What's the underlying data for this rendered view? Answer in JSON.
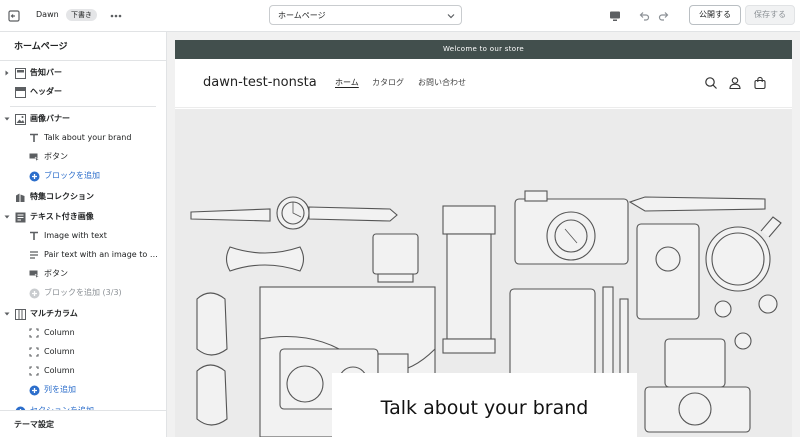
{
  "topbar": {
    "theme_name": "Dawn",
    "status_badge": "下書き",
    "page_select_value": "ホームページ",
    "publish_label": "公開する",
    "save_label": "保存する"
  },
  "sidebar": {
    "title": "ホームページ",
    "sections": [
      {
        "label": "告知バー",
        "icon": "announcement-icon"
      },
      {
        "label": "ヘッダー",
        "icon": "header-icon"
      },
      {
        "label": "画像バナー",
        "icon": "image-icon"
      },
      {
        "label": "Talk about your brand",
        "icon": "text-icon"
      },
      {
        "label": "ボタン",
        "icon": "button-icon"
      },
      {
        "label": "ブロックを追加",
        "icon": "add-icon"
      },
      {
        "label": "特集コレクション",
        "icon": "collection-icon"
      },
      {
        "label": "テキスト付き画像",
        "icon": "image-text-icon"
      },
      {
        "label": "Image with text",
        "icon": "text-icon"
      },
      {
        "label": "Pair text with an image to focus on your chosen product, collection, or blog post.",
        "icon": "paragraph-icon"
      },
      {
        "label": "ボタン",
        "icon": "button-icon"
      },
      {
        "label": "ブロックを追加 (3/3)",
        "icon": "add-icon"
      },
      {
        "label": "マルチカラム",
        "icon": "columns-icon"
      },
      {
        "label": "Column",
        "icon": "column-icon"
      },
      {
        "label": "Column",
        "icon": "column-icon"
      },
      {
        "label": "Column",
        "icon": "column-icon"
      },
      {
        "label": "列を追加",
        "icon": "add-icon"
      },
      {
        "label": "セクションを追加",
        "icon": "add-icon"
      }
    ],
    "footer_label": "テーマ設定"
  },
  "preview": {
    "announcement": "Welcome to our store",
    "store_name": "dawn-test-nonsta",
    "nav": [
      "ホーム",
      "カタログ",
      "お問い合わせ"
    ],
    "banner_heading": "Talk about your brand"
  },
  "colors": {
    "announcement_bg": "#424f4d",
    "accent_blue": "#2c6ecb",
    "banner_bg": "#ebebeb"
  }
}
